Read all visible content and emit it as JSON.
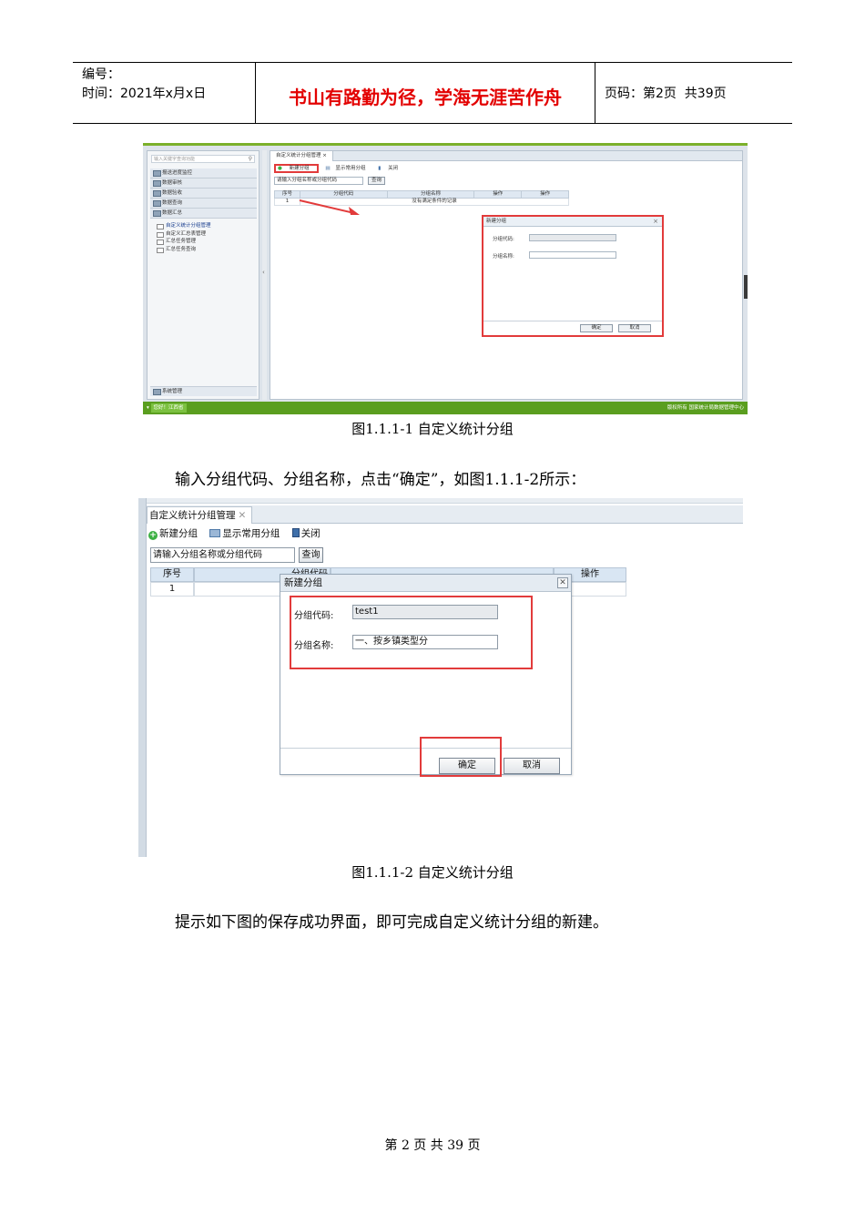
{
  "header": {
    "number_label": "编号：",
    "time_label": "时间：2021年x月x日",
    "motto": "书山有路勤为径，学海无涯苦作舟",
    "page_info": "页码：第2页  共39页"
  },
  "shot1": {
    "search_placeholder": "输入关键字查询功能",
    "nav_items": [
      "报送进度监控",
      "数据审核",
      "数据验收",
      "数据查询",
      "数据汇总"
    ],
    "sub_items": [
      "自定义统计分组管理",
      "自定义汇总表管理",
      "汇总任务管理",
      "汇总任务查询"
    ],
    "system_item": "系统管理",
    "tab_label": "自定义统计分组管理",
    "toolbar": [
      "新建分组",
      "显示常用分组",
      "关闭"
    ],
    "filter_placeholder": "请输入分组名称或分组代码",
    "query_button": "查询",
    "grid_headers": [
      "序号",
      "分组代码",
      "分组名称",
      "操作",
      "操作"
    ],
    "grid_row_index": "1",
    "grid_empty_text": "没有满足条件的记录",
    "dialog_title": "新建分组",
    "dialog_code_label": "分组代码:",
    "dialog_name_label": "分组名称:",
    "ok_button": "确定",
    "cancel_button": "取消",
    "status_left": "您好！江西省",
    "status_right": "版权所有 国家统计局数据管理中心"
  },
  "caption1": "图1.1.1-1 自定义统计分组",
  "paragraph1": "输入分组代码、分组名称，点击“确定”，如图1.1.1-2所示：",
  "shot2": {
    "tab_label": "自定义统计分组管理",
    "toolbar": [
      "新建分组",
      "显示常用分组",
      "关闭"
    ],
    "filter_value": "请输入分组名称或分组代码",
    "query_button": "查询",
    "grid_headers": [
      "序号",
      "分组代码",
      "操作"
    ],
    "grid_row_index": "1",
    "dialog_title": "新建分组",
    "code_label": "分组代码:",
    "code_value": "test1",
    "name_label": "分组名称:",
    "name_value": "一、按乡镇类型分",
    "ok_button": "确定",
    "cancel_button": "取消"
  },
  "caption2": "图1.1.1-2 自定义统计分组",
  "paragraph2": "提示如下图的保存成功界面，即可完成自定义统计分组的新建。",
  "footer": "第 2 页 共 39 页",
  "colors": {
    "motto": "#e30000",
    "highlight_box": "#e23b3b",
    "status_bar": "#5a9e1f"
  }
}
